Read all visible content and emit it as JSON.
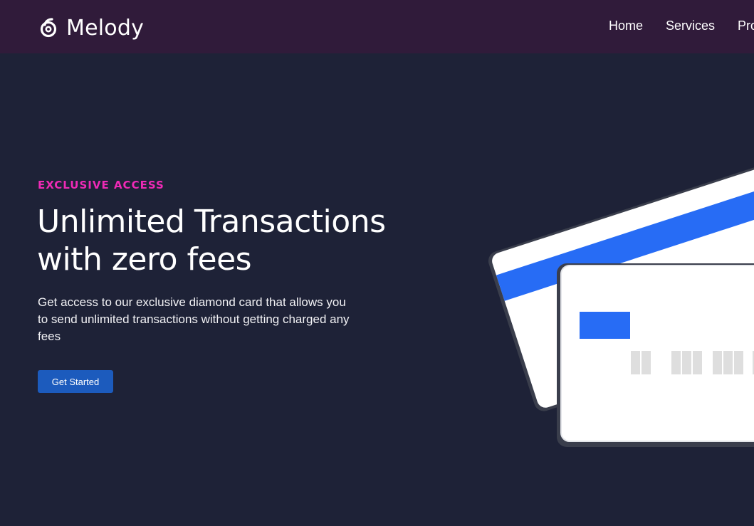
{
  "brand": {
    "name": "Melody",
    "logo_icon": "melody-logo-icon"
  },
  "nav": {
    "items": [
      {
        "label": "Home"
      },
      {
        "label": "Services"
      },
      {
        "label": "Products"
      }
    ]
  },
  "hero": {
    "eyebrow": "EXCLUSIVE ACCESS",
    "headline_line1": "Unlimited Transactions",
    "headline_line2": "with zero fees",
    "description": "Get access to our exclusive diamond card that allows you to send unlimited transactions without getting charged any fees",
    "cta_label": "Get Started"
  },
  "colors": {
    "navbar_bg": "#301b3a",
    "hero_bg": "#1e2237",
    "eyebrow": "#ef2ab6",
    "button": "#1c5bbd",
    "card_stripe": "#276cf5",
    "card_chip": "#276cf5"
  },
  "illustration": {
    "type": "credit-cards",
    "icons": [
      "back-credit-card-icon",
      "front-credit-card-icon"
    ]
  }
}
